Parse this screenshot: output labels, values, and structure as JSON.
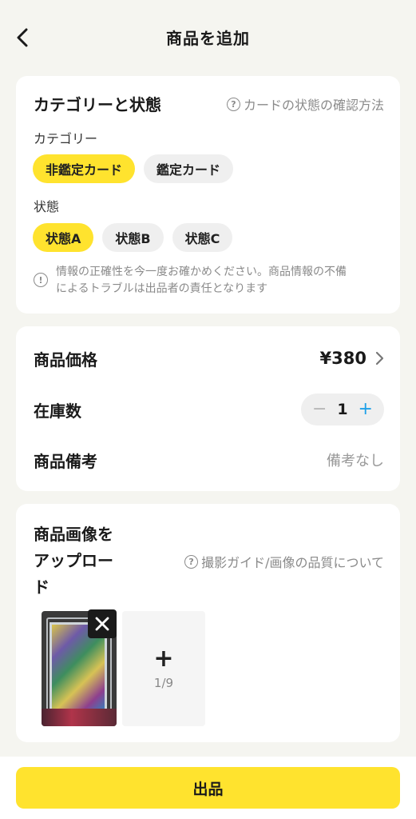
{
  "header": {
    "title": "商品を追加"
  },
  "category_section": {
    "title": "カテゴリーと状態",
    "help_link": "カードの状態の確認方法",
    "category_label": "カテゴリー",
    "category_options": [
      "非鑑定カード",
      "鑑定カード"
    ],
    "selected_category": "非鑑定カード",
    "condition_label": "状態",
    "condition_options": [
      "状態A",
      "状態B",
      "状態C"
    ],
    "selected_condition": "状態A",
    "notice_line1": "情報の正確性を今一度お確かめください。商品情報の不備",
    "notice_line2": "によるトラブルは出品者の責任となります"
  },
  "details_section": {
    "price_label": "商品価格",
    "price_value": "¥380",
    "stock_label": "在庫数",
    "stock_value": "1",
    "stock_minus": "−",
    "stock_plus": "+",
    "memo_label": "商品備考",
    "memo_value": "備考なし"
  },
  "upload_section": {
    "title_line1": "商品画像を",
    "title_line2": "アップロー",
    "title_line3": "ド",
    "help_link": "撮影ガイド/画像の品質について",
    "add_symbol": "+",
    "image_count": "1/9"
  },
  "footer": {
    "submit_label": "出品"
  },
  "colors": {
    "accent": "#ffe32e",
    "plus_blue": "#1ea0e8",
    "background": "#f5f5f0"
  },
  "icons": [
    "back-arrow-icon",
    "question-circle-icon",
    "exclamation-circle-icon",
    "chevron-right-icon",
    "close-icon",
    "plus-icon"
  ]
}
